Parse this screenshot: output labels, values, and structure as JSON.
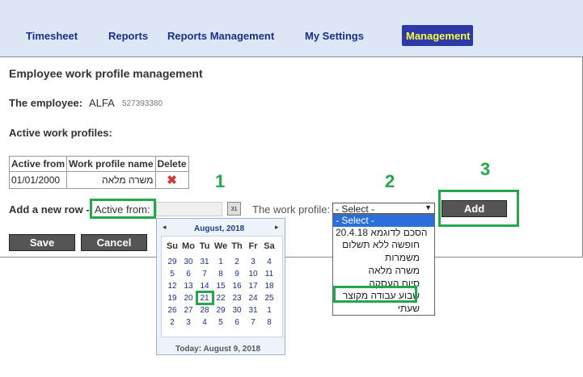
{
  "nav": {
    "timesheet": "Timesheet",
    "reports": "Reports",
    "reports_management": "Reports Management",
    "my_settings": "My Settings",
    "management": "Management"
  },
  "page": {
    "title": "Employee work profile management",
    "employee_label": "The employee:",
    "employee_name": "ALFA",
    "employee_id": "527393380",
    "active_profiles_label": "Active work profiles:"
  },
  "table": {
    "headers": [
      "Active from",
      "Work profile name",
      "Delete"
    ],
    "rows": [
      {
        "active_from": "01/01/2000",
        "profile": "משרה מלאה",
        "delete_icon": "delete-x-icon"
      }
    ]
  },
  "form": {
    "add_row_label": "Add a new row -",
    "active_from_label": "Active from:",
    "active_from_value": "",
    "work_profile_label": "The work profile:",
    "select_value": "- Select -",
    "add_button": "Add",
    "save_button": "Save",
    "cancel_button": "Cancel"
  },
  "dropdown": {
    "options": [
      "- Select -",
      "20.4.18 הסכם לדוגמא",
      "חופשה ללא תשלום",
      "משמרות",
      "משרה מלאה",
      "סיום העסקה",
      "שבוע עבודה מקוצר",
      "שעתי"
    ],
    "selected_index": 0,
    "highlighted_index": 6
  },
  "calendar": {
    "month_title": "August, 2018",
    "prev": "◂",
    "next": "▸",
    "weekdays": [
      "Su",
      "Mo",
      "Tu",
      "We",
      "Th",
      "Fr",
      "Sa"
    ],
    "weeks": [
      [
        "29",
        "30",
        "31",
        "1",
        "2",
        "3",
        "4"
      ],
      [
        "5",
        "6",
        "7",
        "8",
        "9",
        "10",
        "11"
      ],
      [
        "12",
        "13",
        "14",
        "15",
        "16",
        "17",
        "18"
      ],
      [
        "19",
        "20",
        "21",
        "22",
        "23",
        "24",
        "25"
      ],
      [
        "26",
        "27",
        "28",
        "29",
        "30",
        "31",
        "1"
      ],
      [
        "2",
        "3",
        "4",
        "5",
        "6",
        "7",
        "8"
      ]
    ],
    "highlighted_day": "21",
    "today_text": "Today: August 9, 2018"
  },
  "annotations": {
    "one": "1",
    "two": "2",
    "three": "3"
  },
  "colors": {
    "nav_bg": "#dde6f5",
    "nav_text": "#1a2f8a",
    "active_tab_bg": "#2d39a8",
    "active_tab_text": "#f4ff3a",
    "button_bg": "#555555",
    "highlight_green": "#22a84a",
    "dropdown_selected": "#2a6fdb"
  }
}
